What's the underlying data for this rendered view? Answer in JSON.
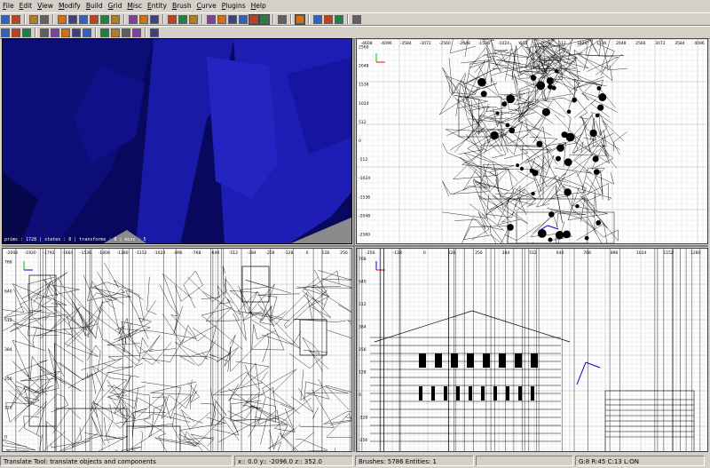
{
  "menu": [
    "File",
    "Edit",
    "View",
    "Modify",
    "Build",
    "Grid",
    "Misc",
    "Entity",
    "Brush",
    "Curve",
    "Plugins",
    "Help"
  ],
  "toolbar1": [
    {
      "icon": "open-file-icon"
    },
    {
      "icon": "save-file-icon"
    },
    {
      "sep": true
    },
    {
      "icon": "undo-icon"
    },
    {
      "icon": "redo-icon"
    },
    {
      "sep": true
    },
    {
      "icon": "flip-x-icon"
    },
    {
      "icon": "rotate-x-icon"
    },
    {
      "icon": "flip-y-icon"
    },
    {
      "icon": "rotate-y-icon"
    },
    {
      "icon": "flip-z-icon"
    },
    {
      "icon": "rotate-z-icon"
    },
    {
      "sep": true
    },
    {
      "icon": "select-complete-tall-icon"
    },
    {
      "icon": "select-touching-icon"
    },
    {
      "icon": "select-inside-icon"
    },
    {
      "sep": true
    },
    {
      "icon": "csg-subtract-icon"
    },
    {
      "icon": "csg-merge-icon"
    },
    {
      "icon": "hollow-icon"
    },
    {
      "sep": true
    },
    {
      "icon": "clipper-icon"
    },
    {
      "icon": "translate-icon"
    },
    {
      "icon": "rotate-tool-icon"
    },
    {
      "icon": "scale-tool-icon"
    },
    {
      "icon": "drag-vertex-icon",
      "pressed": true
    },
    {
      "icon": "drag-edge-icon",
      "pressed": true
    },
    {
      "sep": true
    },
    {
      "icon": "shade-toggle-icon"
    },
    {
      "sep": true
    },
    {
      "icon": "show-entities-icon",
      "pressed": true
    },
    {
      "sep": true
    },
    {
      "icon": "texture-lock-icon"
    },
    {
      "icon": "patch-matrix-icon"
    },
    {
      "icon": "patch-inspector-icon"
    },
    {
      "sep": true
    },
    {
      "icon": "plugin-icon"
    }
  ],
  "toolbar2": [
    {
      "icon": "prefab-green-icon"
    },
    {
      "icon": "patch-bevel-icon"
    },
    {
      "icon": "patch-texture-icon"
    },
    {
      "sep": true
    },
    {
      "icon": "patch-cap-icon"
    },
    {
      "icon": "insert-row-icon"
    },
    {
      "icon": "entity-black-icon"
    },
    {
      "icon": "camera-move-icon"
    },
    {
      "icon": "entity-red-icon"
    },
    {
      "sep": true
    },
    {
      "icon": "cube-orange-1-icon"
    },
    {
      "icon": "cube-orange-2-icon"
    },
    {
      "icon": "cube-orange-3-icon"
    },
    {
      "icon": "cube-orange-4-icon"
    },
    {
      "sep": true
    },
    {
      "icon": "no-clip-icon"
    }
  ],
  "viewports": {
    "camera": {
      "stats": "prims : 1728 | states : 8 | transforms : 8 | misc : 5"
    },
    "top": {
      "xticks": [
        "-4608",
        "-4096",
        "-3584",
        "-3072",
        "-2560",
        "-2048",
        "-1536",
        "-1024",
        "-512",
        "0",
        "512",
        "1024",
        "1536",
        "2048",
        "2560",
        "3072",
        "3584",
        "4096"
      ],
      "yticks": [
        "2560",
        "2048",
        "1536",
        "1024",
        "512",
        "0",
        "-512",
        "-1024",
        "-1536",
        "-2048",
        "-2560"
      ]
    },
    "side": {
      "xticks": [
        "-2048",
        "-1920",
        "-1792",
        "-1664",
        "-1536",
        "-1408",
        "-1280",
        "-1152",
        "-1024",
        "-896",
        "-768",
        "-640",
        "-512",
        "-384",
        "-256",
        "-128",
        "0",
        "128",
        "256"
      ],
      "yticks": [
        "768",
        "640",
        "512",
        "384",
        "256",
        "128",
        "0"
      ]
    },
    "front": {
      "xticks": [
        "-256",
        "-128",
        "0",
        "128",
        "256",
        "384",
        "512",
        "640",
        "768",
        "896",
        "1024",
        "1152",
        "1280"
      ],
      "yticks": [
        "768",
        "640",
        "512",
        "384",
        "256",
        "128",
        "0",
        "-128",
        "-256"
      ]
    }
  },
  "status": {
    "tool": "Translate Tool: translate objects and components",
    "coords": "x::   0.0  y:: -2096.0  z::   352.0",
    "counts": "Brushes: 5786 Entities: 1",
    "grid": "G:8  R:45  C:13  L:ON"
  },
  "colors": {
    "camera_bg": "#0a0a70",
    "brush_blue": "#1c1cb0",
    "floor_gray": "#8a8a8a",
    "grid_minor": "#e4e4e4",
    "grid_major": "#b0b0b0",
    "wire": "#000000",
    "axis_green": "#00c000",
    "axis_red": "#ff0000",
    "axis_blue": "#0000ff"
  }
}
